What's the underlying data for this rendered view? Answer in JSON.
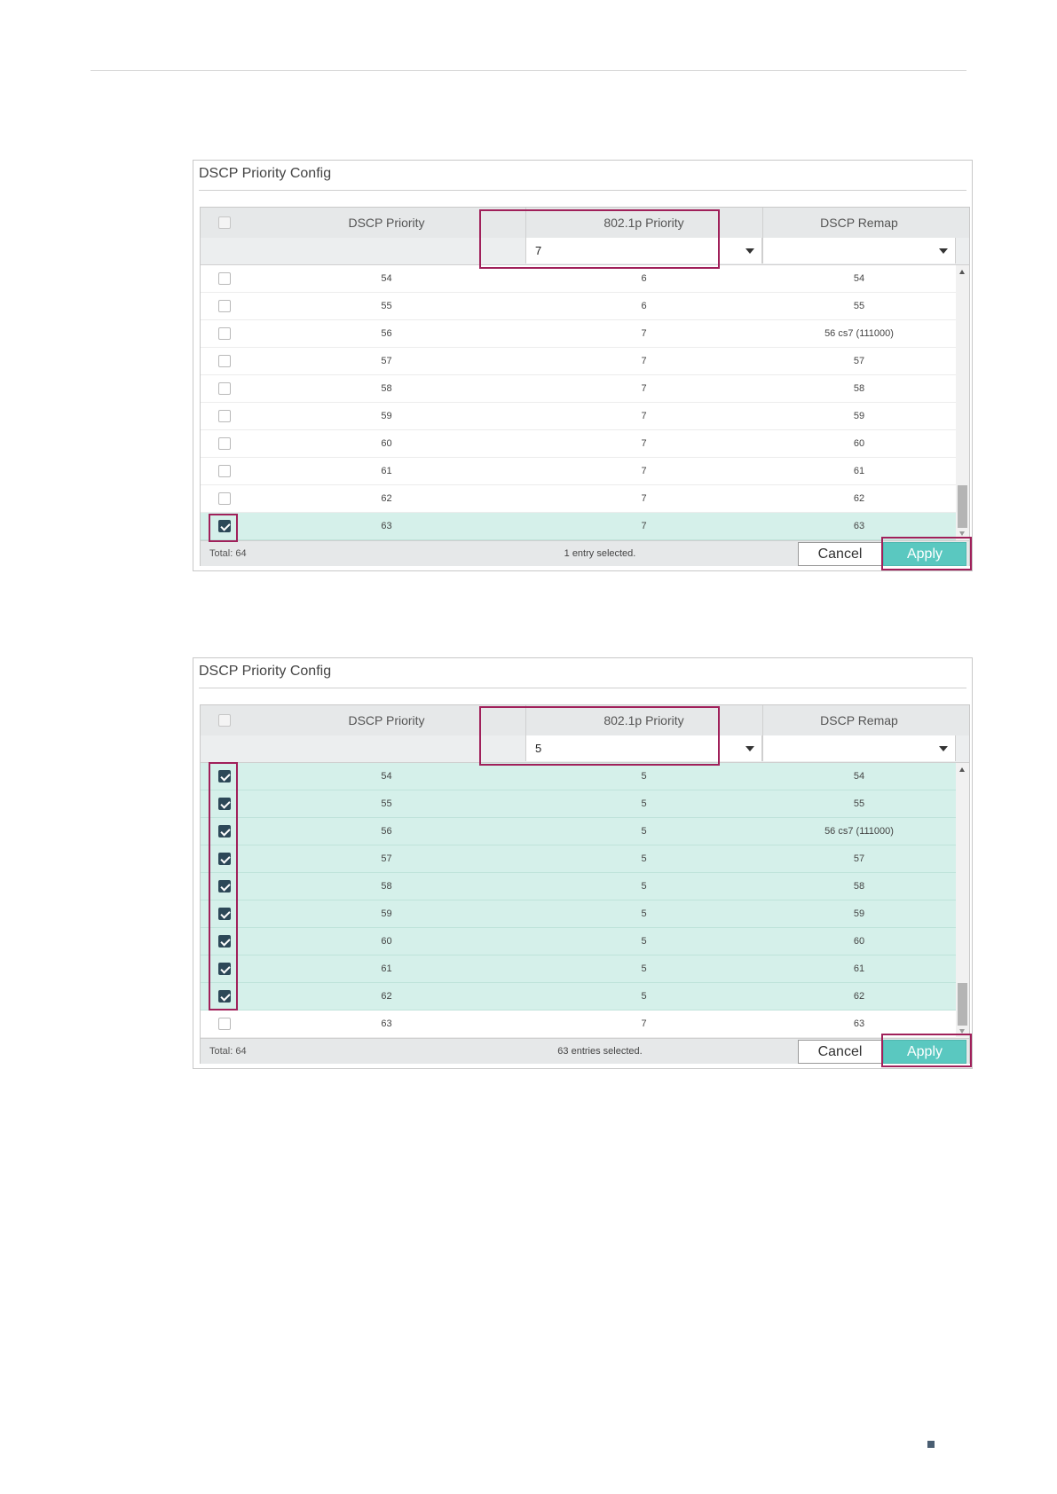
{
  "panels": [
    {
      "title": "DSCP Priority Config",
      "columns": {
        "dscp": "DSCP Priority",
        "dot1p": "802.1p Priority",
        "remap": "DSCP Remap"
      },
      "filter": {
        "dot1p_value": "7",
        "remap_value": ""
      },
      "rows": [
        {
          "dscp": "54",
          "dot1p": "6",
          "remap": "54",
          "checked": false
        },
        {
          "dscp": "55",
          "dot1p": "6",
          "remap": "55",
          "checked": false
        },
        {
          "dscp": "56",
          "dot1p": "7",
          "remap": "56 cs7 (111000)",
          "checked": false
        },
        {
          "dscp": "57",
          "dot1p": "7",
          "remap": "57",
          "checked": false
        },
        {
          "dscp": "58",
          "dot1p": "7",
          "remap": "58",
          "checked": false
        },
        {
          "dscp": "59",
          "dot1p": "7",
          "remap": "59",
          "checked": false
        },
        {
          "dscp": "60",
          "dot1p": "7",
          "remap": "60",
          "checked": false
        },
        {
          "dscp": "61",
          "dot1p": "7",
          "remap": "61",
          "checked": false
        },
        {
          "dscp": "62",
          "dot1p": "7",
          "remap": "62",
          "checked": false
        },
        {
          "dscp": "63",
          "dot1p": "7",
          "remap": "63",
          "checked": true
        }
      ],
      "footer": {
        "total": "Total: 64",
        "selection": "1 entry selected.",
        "cancel": "Cancel",
        "apply": "Apply"
      }
    },
    {
      "title": "DSCP Priority Config",
      "columns": {
        "dscp": "DSCP Priority",
        "dot1p": "802.1p Priority",
        "remap": "DSCP Remap"
      },
      "filter": {
        "dot1p_value": "5",
        "remap_value": ""
      },
      "rows": [
        {
          "dscp": "54",
          "dot1p": "5",
          "remap": "54",
          "checked": true
        },
        {
          "dscp": "55",
          "dot1p": "5",
          "remap": "55",
          "checked": true
        },
        {
          "dscp": "56",
          "dot1p": "5",
          "remap": "56 cs7 (111000)",
          "checked": true
        },
        {
          "dscp": "57",
          "dot1p": "5",
          "remap": "57",
          "checked": true
        },
        {
          "dscp": "58",
          "dot1p": "5",
          "remap": "58",
          "checked": true
        },
        {
          "dscp": "59",
          "dot1p": "5",
          "remap": "59",
          "checked": true
        },
        {
          "dscp": "60",
          "dot1p": "5",
          "remap": "60",
          "checked": true
        },
        {
          "dscp": "61",
          "dot1p": "5",
          "remap": "61",
          "checked": true
        },
        {
          "dscp": "62",
          "dot1p": "5",
          "remap": "62",
          "checked": true
        },
        {
          "dscp": "63",
          "dot1p": "7",
          "remap": "63",
          "checked": false
        }
      ],
      "footer": {
        "total": "Total: 64",
        "selection": "63 entries selected.",
        "cancel": "Cancel",
        "apply": "Apply"
      }
    }
  ]
}
